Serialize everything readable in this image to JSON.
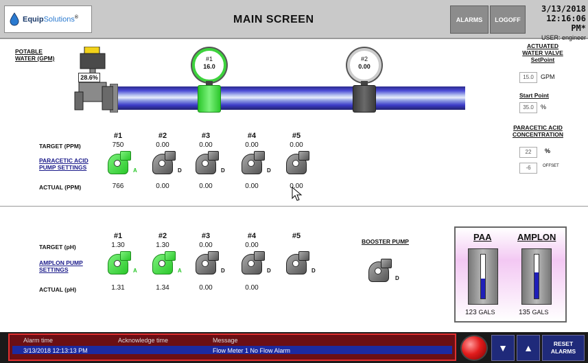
{
  "header": {
    "logo_text_bold": "Equip",
    "logo_text": "Solutions",
    "logo_reg": "®",
    "title": "MAIN SCREEN",
    "alarms_label": "ALARMS",
    "logoff_label": "LOGOFF",
    "date": "3/13/2018",
    "time": "12:16:06 PM*",
    "user": "USER: engineer"
  },
  "potable": {
    "label_line1": "POTABLE",
    "label_line2": "WATER (GPM)",
    "valve_readout": "28.6%"
  },
  "meters": [
    {
      "label": "#1",
      "value": "16.0",
      "state": "green"
    },
    {
      "label": "#2",
      "value": "0.00",
      "state": "gray"
    }
  ],
  "actuated_valve": {
    "title_line1": "ACTUATED",
    "title_line2": "WATER VALVE",
    "setpoint_label": "SetPoint",
    "setpoint_value": "15.0",
    "setpoint_unit": "GPM",
    "startpoint_label": "Start Point",
    "startpoint_value": "35.0",
    "startpoint_unit": "%"
  },
  "paa_concentration": {
    "title_line1": "PARACETIC ACID",
    "title_line2": "CONCENTRATION",
    "value": "22",
    "unit": "%",
    "offset_value": "-6",
    "offset_label": "OFFSET"
  },
  "paa_pumps": {
    "target_label": "TARGET (PPM)",
    "settings_label_line1": "PARACETIC ACID",
    "settings_label_line2": "PUMP SETTINGS",
    "actual_label": "ACTUAL (PPM)",
    "pumps": [
      {
        "num": "#1",
        "target": "750",
        "actual": "766",
        "status": "A",
        "state": "green"
      },
      {
        "num": "#2",
        "target": "0.00",
        "actual": "0.00",
        "status": "D",
        "state": "gray"
      },
      {
        "num": "#3",
        "target": "0.00",
        "actual": "0.00",
        "status": "D",
        "state": "gray"
      },
      {
        "num": "#4",
        "target": "0.00",
        "actual": "0.00",
        "status": "D",
        "state": "gray"
      },
      {
        "num": "#5",
        "target": "0.00",
        "actual": "0.00",
        "status": "",
        "state": "gray"
      }
    ]
  },
  "amplon_pumps": {
    "target_label": "TARGET (pH)",
    "settings_label_line1": "AMPLON PUMP",
    "settings_label_line2": "SETTINGS",
    "actual_label": "ACTUAL (pH)",
    "pumps": [
      {
        "num": "#1",
        "target": "1.30",
        "actual": "1.31",
        "status": "A",
        "state": "green"
      },
      {
        "num": "#2",
        "target": "1.30",
        "actual": "1.34",
        "status": "A",
        "state": "green"
      },
      {
        "num": "#3",
        "target": "0.00",
        "actual": "0.00",
        "status": "D",
        "state": "gray"
      },
      {
        "num": "#4",
        "target": "0.00",
        "actual": "0.00",
        "status": "D",
        "state": "gray"
      },
      {
        "num": "#5",
        "target": "",
        "actual": "",
        "status": "D",
        "state": "gray"
      }
    ]
  },
  "booster": {
    "label": "BOOSTER PUMP",
    "status": "D"
  },
  "tanks": [
    {
      "name": "PAA",
      "gallons": "123",
      "unit": "GALS",
      "level": 0.45
    },
    {
      "name": "AMPLON",
      "gallons": "135",
      "unit": "GALS",
      "level": 0.6
    }
  ],
  "alarm_bar": {
    "col_time": "Alarm time",
    "col_ack": "Acknowledge time",
    "col_msg": "Message",
    "row_time": "3/13/2018 12:13:13 PM",
    "row_ack": "",
    "row_msg": "Flow Meter 1 No Flow Alarm"
  },
  "controls": {
    "down_arrow": "▼",
    "up_arrow": "▲",
    "reset_line1": "RESET",
    "reset_line2": "ALARMS"
  },
  "colors": {
    "active_green": "#2bc72b",
    "inactive_gray": "#666666",
    "pipe_blue": "#3c3cc8",
    "alarm_red": "#e21c1c",
    "tank_fill": "#1f1fb8"
  }
}
